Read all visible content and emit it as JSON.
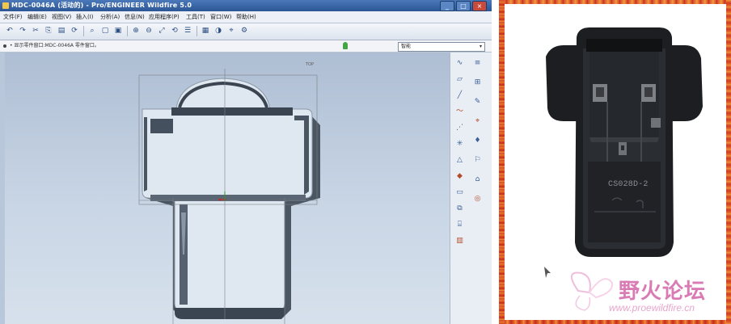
{
  "window": {
    "title": "MDC-0046A (活动的) - Pro/ENGINEER Wildfire 5.0",
    "buttons": {
      "minimize": "_",
      "maximize": "□",
      "close": "×"
    }
  },
  "menu": [
    "文件(F)",
    "编辑(E)",
    "视图(V)",
    "插入(I)",
    "分析(A)",
    "信息(N)",
    "应用程序(P)",
    "工具(T)",
    "窗口(W)",
    "帮助(H)"
  ],
  "status": {
    "message": "• 显示零件窗口:MDC-0046A 零件窗口。",
    "filter_value": "智能",
    "filter_arrow": "▾"
  },
  "viewport": {
    "datum_label": "TOP",
    "accent_axis": "#cc2222",
    "accent_csys": "#2a9a2a",
    "model_color": "#dfe7f1",
    "model_shade": "#3f4a56"
  },
  "toolbar_icons": [
    "undo-icon",
    "redo-icon",
    "cut-icon",
    "copy-icon",
    "paste-icon",
    "regenerate-icon",
    "find-icon",
    "select-icon",
    "repaint-icon",
    "zoom-in-icon",
    "zoom-out-icon",
    "refit-icon",
    "orient-icon",
    "saved-views-icon",
    "layer-icon",
    "model-display-icon",
    "datum-icon",
    "settings-icon"
  ],
  "toolbar_glyphs": [
    "↶",
    "↷",
    "✂",
    "⎘",
    "▤",
    "⟳",
    "⌕",
    "▢",
    "▣",
    "⊕",
    "⊖",
    "⤢",
    "⟲",
    "☰",
    "▦",
    "◑",
    "⌖",
    "⚙"
  ],
  "right_icons": [
    "∿",
    "▱",
    "╱",
    "〜",
    "⋰",
    "✳",
    "△",
    "◆",
    "▭",
    "⧉",
    "⌸",
    "▥",
    "≡",
    "⊞",
    "✎",
    "⌖",
    "♦",
    "⚐",
    "⌂",
    "◎"
  ],
  "photo": {
    "part_code": "CS028D-2",
    "watermark_name": "野火论坛",
    "watermark_url": "www.proewildfire.cn",
    "frame_color": "#d64830",
    "part_color": "#1c1e21"
  }
}
